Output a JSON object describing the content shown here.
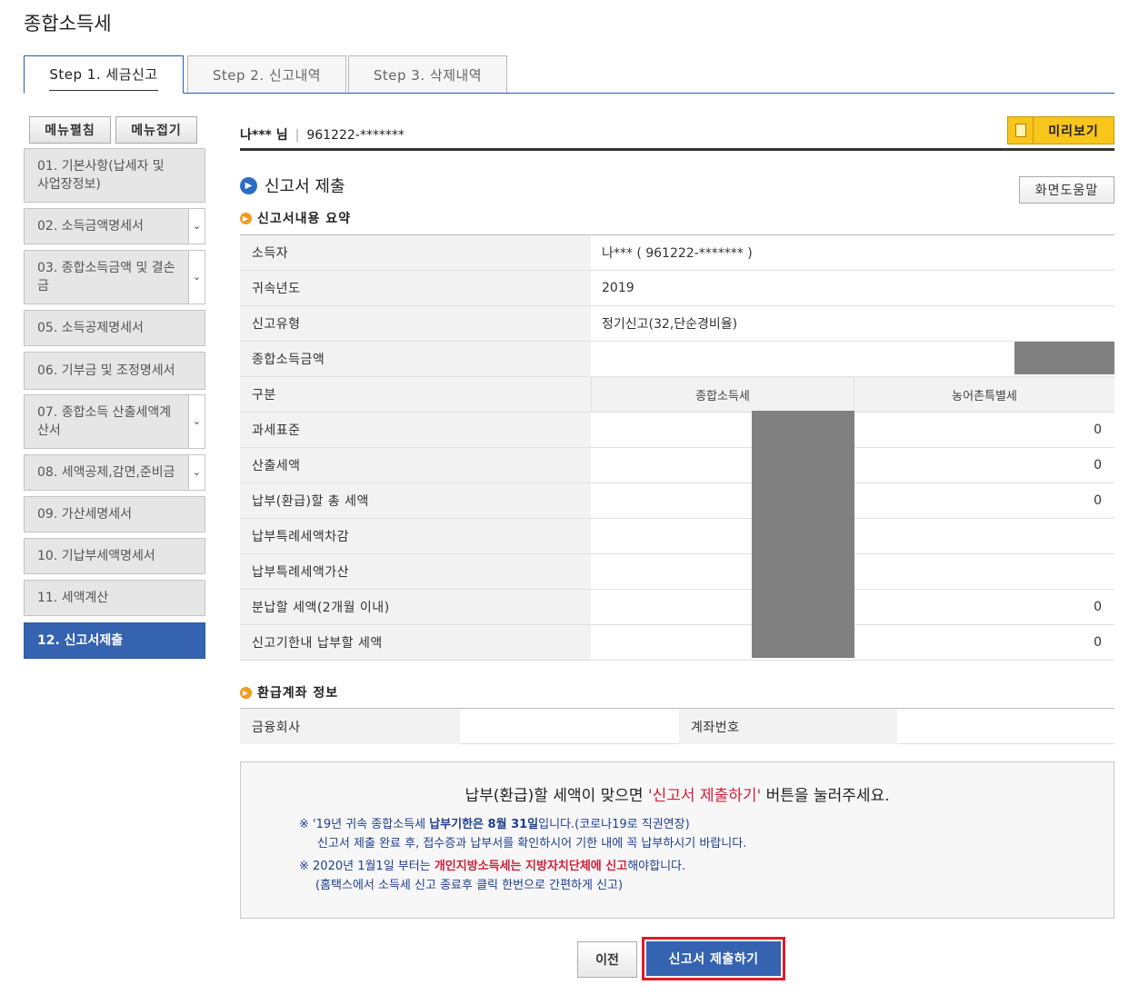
{
  "page": {
    "title": "종합소득세"
  },
  "tabs": [
    {
      "label": "Step 1. 세금신고",
      "active": true
    },
    {
      "label": "Step 2. 신고내역",
      "active": false
    },
    {
      "label": "Step 3. 삭제내역",
      "active": false
    }
  ],
  "sidebar": {
    "expand_label": "메뉴펼침",
    "collapse_label": "메뉴접기",
    "items": [
      {
        "label": "01. 기본사항(납세자 및 사업장정보)"
      },
      {
        "label": "02. 소득금액명세서"
      },
      {
        "label": "03. 종합소득금액 및 결손금"
      },
      {
        "label": "05. 소득공제명세서"
      },
      {
        "label": "06. 기부금 및 조정명세서"
      },
      {
        "label": "07. 종합소득 산출세액계산서"
      },
      {
        "label": "08. 세액공제,감면,준비금"
      },
      {
        "label": "09. 가산세명세서"
      },
      {
        "label": "10. 기납부세액명세서"
      },
      {
        "label": "11. 세액계산"
      },
      {
        "label": "12. 신고서제출",
        "active": true
      }
    ]
  },
  "user": {
    "name": "나*** 님",
    "sep": "|",
    "id": "961222-*******"
  },
  "preview_label": "미리보기",
  "section_title": "신고서 제출",
  "help_label": "화면도움말",
  "summary": {
    "title": "신고서내용 요약",
    "taxpayer_label": "소득자",
    "taxpayer_value": "나***  (  961222-*******  )",
    "year_label": "귀속년도",
    "year_value": "2019",
    "type_label": "신고유형",
    "type_value": "정기신고(32,단순경비율)",
    "income_label": "종합소득금액",
    "col_label": "구분",
    "col1": "종합소득세",
    "col2": "농어촌특별세",
    "rows": [
      {
        "label": "과세표준",
        "c2": "0"
      },
      {
        "label": "산출세액",
        "c2": "0"
      },
      {
        "label": "납부(환급)할 총 세액",
        "c2": "0"
      },
      {
        "label": "납부특례세액차감",
        "c2": ""
      },
      {
        "label": "납부특례세액가산",
        "c2": ""
      },
      {
        "label": "분납할 세액(2개월 이내)",
        "c2": "0"
      },
      {
        "label": "신고기한내 납부할 세액",
        "c2": "0"
      }
    ]
  },
  "refund": {
    "title": "환급계좌 정보",
    "bank_label": "금융회사",
    "account_label": "계좌번호"
  },
  "notice": {
    "main_pre": "납부(환급)할 세액이 맞으면 ",
    "main_red": "'신고서 제출하기'",
    "main_post": " 버튼을 눌러주세요.",
    "note1_a": "※ '19년 귀속 종합소득세 ",
    "note1_b": "납부기한은 8월 31일",
    "note1_c": "입니다.(코로나19로 직권연장)",
    "note1_line2": "신고서 제출 완료 후, 접수증과 납부서를 확인하시어 기한 내에 꼭 납부하시기 바랍니다.",
    "note2_a": "※ 2020년 1월1일 부터는 ",
    "note2_b": "개인지방소득세는 지방자치단체에 신고",
    "note2_c": "해야합니다.",
    "note2_line2": "(홈택스에서 소득세 신고 종료후 클릭 한번으로 간편하게 신고)"
  },
  "buttons": {
    "prev": "이전",
    "submit": "신고서 제출하기"
  },
  "colors": {
    "accent_blue": "#3563b0",
    "highlight_red": "#e01a2a",
    "preview_yellow": "#f8c51c"
  }
}
